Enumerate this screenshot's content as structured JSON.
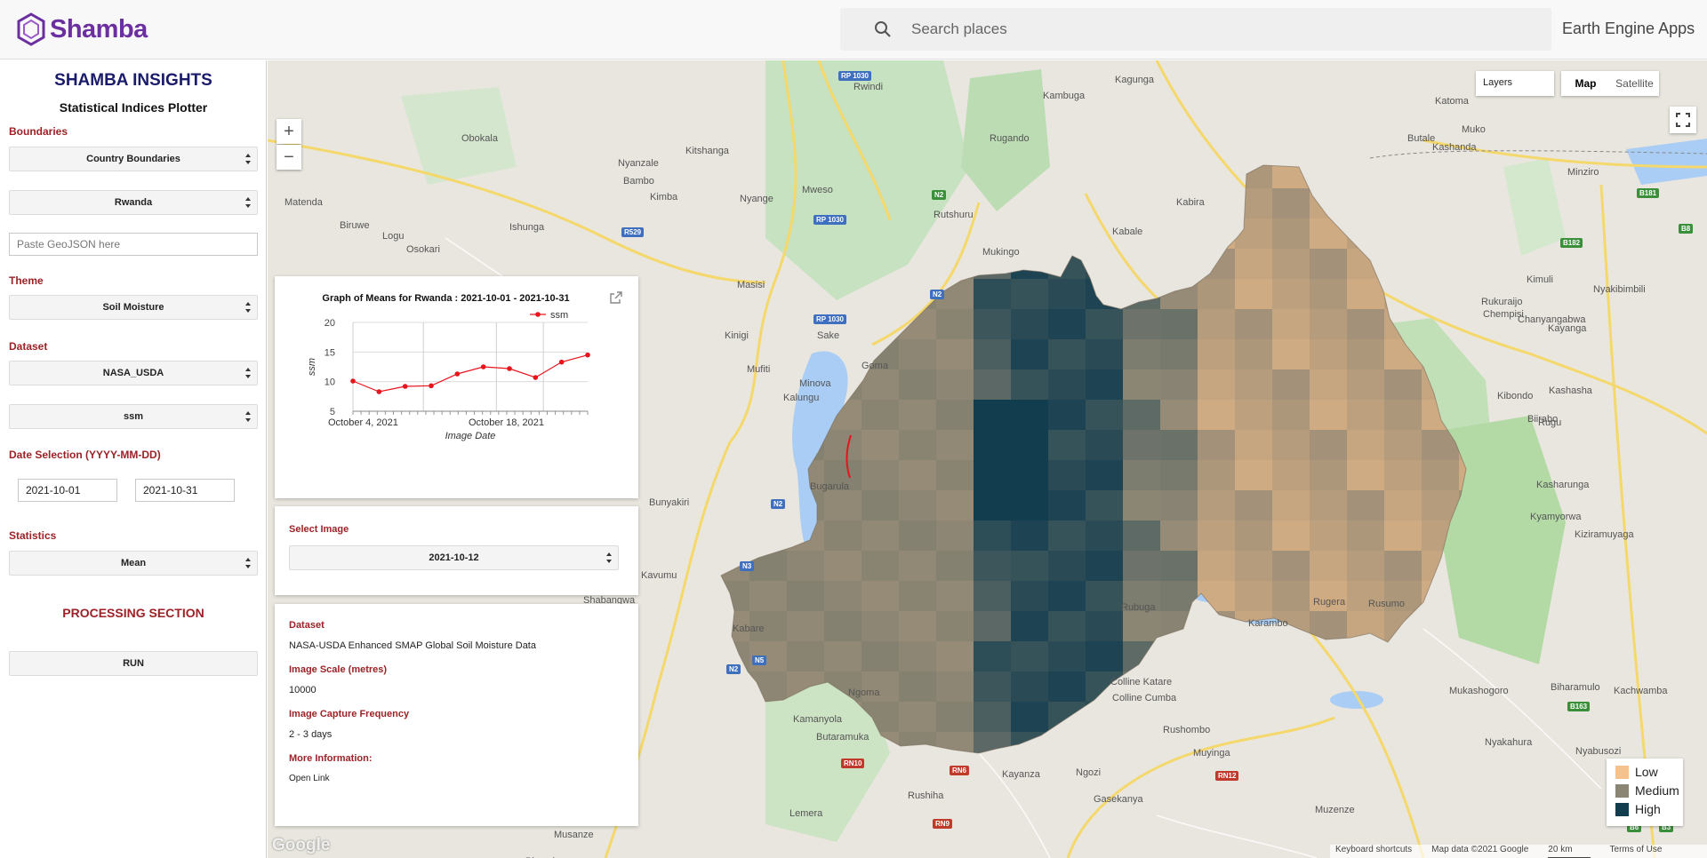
{
  "header": {
    "logo_text": "Shamba",
    "search_placeholder": "Search places",
    "apps_link": "Earth Engine Apps"
  },
  "panel": {
    "title": "SHAMBA INSIGHTS",
    "subtitle": "Statistical Indices Plotter",
    "boundaries_label": "Boundaries",
    "boundary_type": "Country Boundaries",
    "country": "Rwanda",
    "geojson_placeholder": "Paste GeoJSON here",
    "theme_label": "Theme",
    "theme": "Soil Moisture",
    "dataset_label": "Dataset",
    "dataset": "NASA_USDA",
    "band": "ssm",
    "date_label": "Date Selection (YYYY-MM-DD)",
    "start_date": "2021-10-01",
    "end_date": "2021-10-31",
    "statistics_label": "Statistics",
    "statistic": "Mean",
    "processing_label": "PROCESSING SECTION",
    "run_label": "RUN"
  },
  "map_controls": {
    "zoom_in": "+",
    "zoom_out": "−",
    "layers": "Layers",
    "map": "Map",
    "satellite": "Satellite"
  },
  "chart_card": {
    "title": "Graph of Means for Rwanda : 2021-10-01 - 2021-10-31"
  },
  "chart_data": {
    "type": "line",
    "title": "Graph of Means for Rwanda : 2021-10-01 - 2021-10-31",
    "xlabel": "Image Date",
    "ylabel": "ssm",
    "x": [
      "2021-10-01",
      "2021-10-04",
      "2021-10-07",
      "2021-10-10",
      "2021-10-13",
      "2021-10-16",
      "2021-10-19",
      "2021-10-22",
      "2021-10-25",
      "2021-10-28"
    ],
    "series": [
      {
        "name": "ssm",
        "color": "#e8141c",
        "values": [
          10.1,
          8.3,
          9.2,
          9.3,
          11.3,
          12.5,
          12.2,
          10.7,
          13.3,
          14.5
        ]
      }
    ],
    "xtick_labels": [
      "October 4, 2021",
      "October 18, 2021"
    ],
    "yticks": [
      5,
      10,
      15,
      20
    ],
    "ylim": [
      5,
      20
    ],
    "legend_position": "top-right",
    "grid": true
  },
  "select_card": {
    "label": "Select Image",
    "selected": "2021-10-12"
  },
  "info_card": {
    "dataset_label": "Dataset",
    "dataset_value": "NASA-USDA Enhanced SMAP Global Soil Moisture Data",
    "scale_label": "Image Scale (metres)",
    "scale_value": "10000",
    "freq_label": "Image Capture Frequency",
    "freq_value": "2 - 3 days",
    "more_label": "More Information:",
    "link_label": "Open Link"
  },
  "legend": {
    "items": [
      {
        "label": "Low",
        "color": "#f5c18d"
      },
      {
        "label": "Medium",
        "color": "#8b8573"
      },
      {
        "label": "High",
        "color": "#123d4f"
      }
    ]
  },
  "attribution": {
    "logo": "Google",
    "shortcuts": "Keyboard shortcuts",
    "mapdata": "Map data ©2021 Google",
    "scale": "20 km",
    "terms": "Terms of Use"
  },
  "places": [
    {
      "name": "Rwindi"
    },
    {
      "name": "Kagunga"
    },
    {
      "name": "Kambuga"
    },
    {
      "name": "Katoma"
    },
    {
      "name": "Obokala"
    },
    {
      "name": "Kitshanga"
    },
    {
      "name": "Nyanzale"
    },
    {
      "name": "Rugando"
    },
    {
      "name": "Kashanda"
    },
    {
      "name": "Butale"
    },
    {
      "name": "Muko"
    },
    {
      "name": "Bambo"
    },
    {
      "name": "Matenda"
    },
    {
      "name": "Kimba"
    },
    {
      "name": "Mweso"
    },
    {
      "name": "Nyange"
    },
    {
      "name": "Minziro"
    },
    {
      "name": "Biruwe"
    },
    {
      "name": "Logu"
    },
    {
      "name": "Osokari"
    },
    {
      "name": "Ishunga"
    },
    {
      "name": "Rutshuru"
    },
    {
      "name": "Kabira"
    },
    {
      "name": "Mukingo"
    },
    {
      "name": "Kabale"
    },
    {
      "name": "Masisi"
    },
    {
      "name": "Kimuli"
    },
    {
      "name": "Nyakibimbili"
    },
    {
      "name": "Rukuraijo"
    },
    {
      "name": "Chempisi"
    },
    {
      "name": "Kinigi"
    },
    {
      "name": "Sake"
    },
    {
      "name": "Kayanga"
    },
    {
      "name": "Mufiti"
    },
    {
      "name": "Goma"
    },
    {
      "name": "Kibondo"
    },
    {
      "name": "Minova"
    },
    {
      "name": "Kalungu"
    },
    {
      "name": "Kashasha"
    },
    {
      "name": "Rugu"
    },
    {
      "name": "Biirabo"
    },
    {
      "name": "Bugarula"
    },
    {
      "name": "Kasharunga"
    },
    {
      "name": "Bunyakiri"
    },
    {
      "name": "Kyamyorwa"
    },
    {
      "name": "Kiziramuyaga"
    },
    {
      "name": "Kavumu"
    },
    {
      "name": "Rubuga"
    },
    {
      "name": "Rugera"
    },
    {
      "name": "Rusumo"
    },
    {
      "name": "Shabangwa"
    },
    {
      "name": "Kabare"
    },
    {
      "name": "Karambo"
    },
    {
      "name": "Ngoma"
    },
    {
      "name": "Colline Katare"
    },
    {
      "name": "Colline Cumba"
    },
    {
      "name": "Mukashogoro"
    },
    {
      "name": "Biharamulo"
    },
    {
      "name": "Kachwamba"
    },
    {
      "name": "Kamanyola"
    },
    {
      "name": "Rushombo"
    },
    {
      "name": "Butaramuka"
    },
    {
      "name": "Muyinga"
    },
    {
      "name": "Nyakahura"
    },
    {
      "name": "Nyabusozi"
    },
    {
      "name": "Kayanza"
    },
    {
      "name": "Ngozi"
    },
    {
      "name": "Lemera"
    },
    {
      "name": "Rushiha"
    },
    {
      "name": "Gasekanya"
    },
    {
      "name": "Muzenze"
    },
    {
      "name": "Musanze"
    },
    {
      "name": "Bisembe"
    },
    {
      "name": "Chanyangabwa"
    }
  ],
  "road_shields": [
    {
      "text": "RP 1030"
    },
    {
      "text": "N2"
    },
    {
      "text": "R529"
    },
    {
      "text": "B181"
    },
    {
      "text": "B8"
    },
    {
      "text": "B182"
    },
    {
      "text": "N3"
    },
    {
      "text": "N5"
    },
    {
      "text": "RN10"
    },
    {
      "text": "RN6"
    },
    {
      "text": "RN12"
    },
    {
      "text": "RN9"
    },
    {
      "text": "B163"
    },
    {
      "text": "B6"
    },
    {
      "text": "B3"
    }
  ]
}
